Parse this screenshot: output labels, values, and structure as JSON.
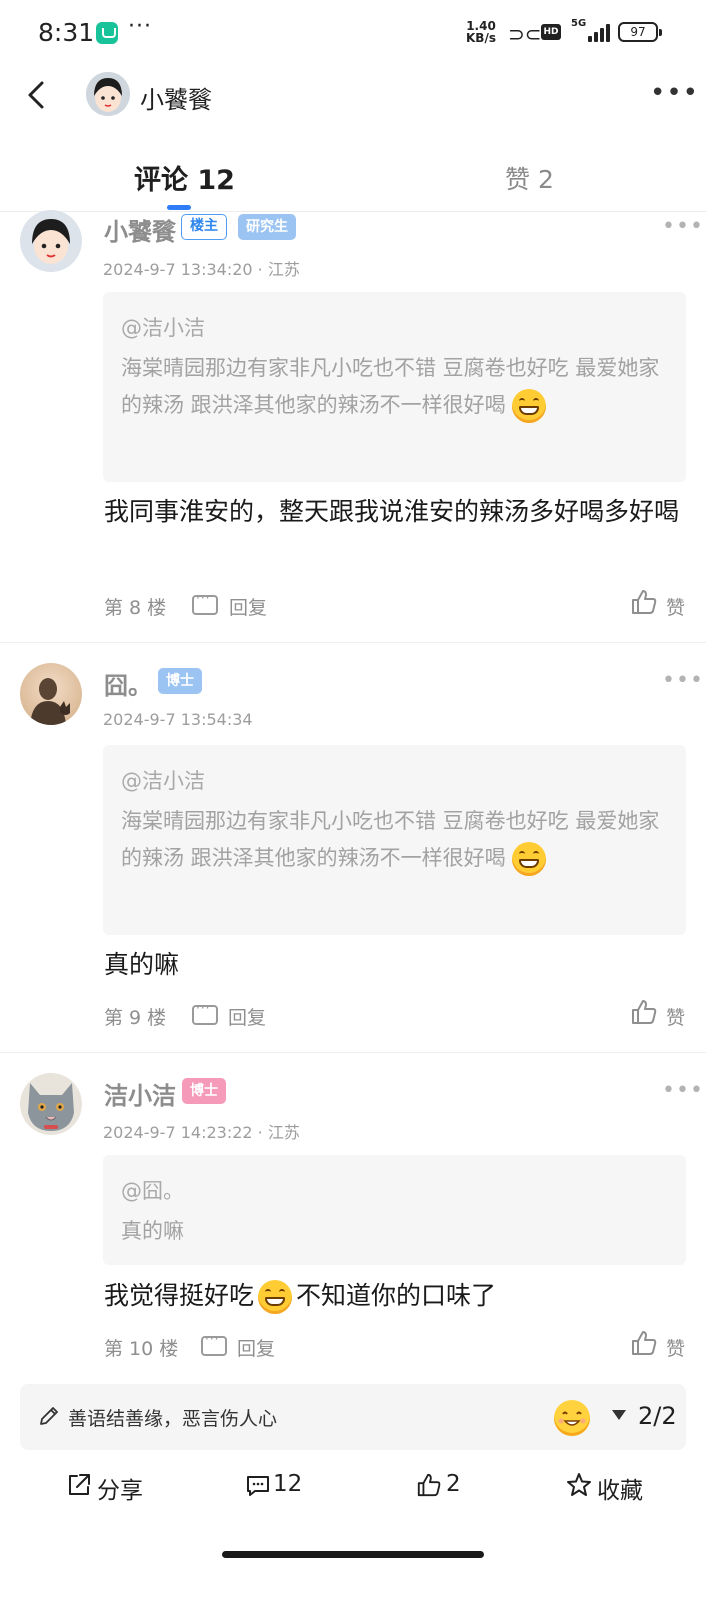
{
  "status_bar": {
    "time": "8:31",
    "overflow": "···",
    "net_speed_value": "1.40",
    "net_speed_unit": "KB/s",
    "hd": "HD",
    "network": "5G",
    "battery": "97"
  },
  "header": {
    "back_icon": "chevron-left-icon",
    "title": "小饕餮",
    "more": "•••"
  },
  "tabs": [
    {
      "label": "评论 12",
      "active": true
    },
    {
      "label": "赞 2",
      "active": false
    }
  ],
  "comments": [
    {
      "name": "小饕餮",
      "badges": [
        "楼主",
        "研究生"
      ],
      "time": "2024-9-7 13:34:20",
      "location": "· 江苏",
      "quote_user": "@洁小洁",
      "quote_text": "海棠晴园那边有家非凡小吃也不错  豆腐卷也好吃  最爱她家的辣汤  跟洪泽其他家的辣汤不一样很好喝",
      "text": "我同事淮安的，整天跟我说淮安的辣汤多好喝多好喝",
      "floor": "第 8 楼",
      "reply": "回复",
      "like": "赞"
    },
    {
      "name": "囧。",
      "badges": [
        "博士"
      ],
      "time": "2024-9-7 13:54:34",
      "location": "",
      "quote_user": "@洁小洁",
      "quote_text": "海棠晴园那边有家非凡小吃也不错  豆腐卷也好吃  最爱她家的辣汤  跟洪泽其他家的辣汤不一样很好喝",
      "text": "真的嘛",
      "floor": "第 9 楼",
      "reply": "回复",
      "like": "赞"
    },
    {
      "name": "洁小洁",
      "badges": [
        "博士"
      ],
      "time": "2024-9-7 14:23:22",
      "location": "· 江苏",
      "quote_user": "@囧。",
      "quote_text": "真的嘛",
      "text_before_emoji": "我觉得挺好吃",
      "text_after_emoji": "不知道你的口味了",
      "floor": "第 10 楼",
      "reply": "回复",
      "like": "赞"
    }
  ],
  "input_bar": {
    "placeholder": "善语结善缘，恶言伤人心",
    "page": "2/2"
  },
  "actions": {
    "share": "分享",
    "comments": "12",
    "likes": "2",
    "favorite": "收藏"
  },
  "colors": {
    "accent": "#2e7cf6",
    "owner_badge": "#2f86ee",
    "grad_badge": "#9cc4f3",
    "phd_badge_blue": "#9cc4f3",
    "phd_badge_pink": "#f59ab8"
  }
}
